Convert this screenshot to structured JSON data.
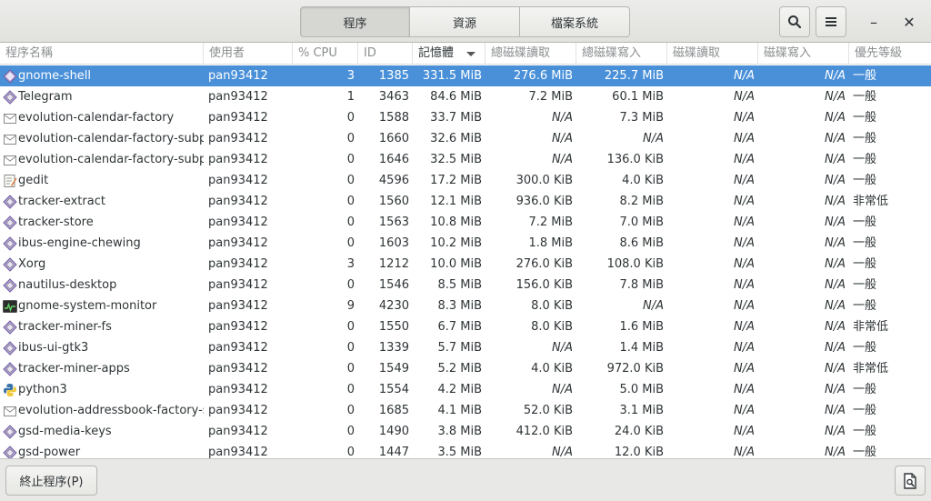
{
  "header": {
    "tabs": [
      {
        "label": "程序",
        "active": true
      },
      {
        "label": "資源",
        "active": false
      },
      {
        "label": "檔案系統",
        "active": false
      }
    ],
    "search_icon": "search-icon",
    "menu_icon": "hamburger-menu-icon",
    "minimize_label": "–",
    "close_label": "✕"
  },
  "columns": [
    {
      "key": "name",
      "label": "程序名稱"
    },
    {
      "key": "user",
      "label": "使用者"
    },
    {
      "key": "cpu",
      "label": "% CPU"
    },
    {
      "key": "id",
      "label": "ID"
    },
    {
      "key": "mem",
      "label": "記憶體",
      "sorted": "descending"
    },
    {
      "key": "disk_read_total",
      "label": "總磁碟讀取"
    },
    {
      "key": "disk_write_total",
      "label": "總磁碟寫入"
    },
    {
      "key": "disk_read",
      "label": "磁碟讀取"
    },
    {
      "key": "disk_write",
      "label": "磁碟寫入"
    },
    {
      "key": "priority",
      "label": "優先等級"
    }
  ],
  "processes": [
    {
      "name": "gnome-shell",
      "icon": "gear-icon",
      "user": "pan93412",
      "cpu": "3",
      "id": "1385",
      "mem": "331.5 MiB",
      "disk_read_total": "276.6 MiB",
      "disk_write_total": "225.7 MiB",
      "disk_read": "N/A",
      "disk_write": "N/A",
      "priority": "一般",
      "selected": true
    },
    {
      "name": "Telegram",
      "icon": "gear-icon",
      "user": "pan93412",
      "cpu": "1",
      "id": "3463",
      "mem": "84.6 MiB",
      "disk_read_total": "7.2 MiB",
      "disk_write_total": "60.1 MiB",
      "disk_read": "N/A",
      "disk_write": "N/A",
      "priority": "一般"
    },
    {
      "name": "evolution-calendar-factory",
      "icon": "envelope-icon",
      "user": "pan93412",
      "cpu": "0",
      "id": "1588",
      "mem": "33.7 MiB",
      "disk_read_total": "N/A",
      "disk_write_total": "7.3 MiB",
      "disk_read": "N/A",
      "disk_write": "N/A",
      "priority": "一般"
    },
    {
      "name": "evolution-calendar-factory-subprocess",
      "icon": "envelope-icon",
      "user": "pan93412",
      "cpu": "0",
      "id": "1660",
      "mem": "32.6 MiB",
      "disk_read_total": "N/A",
      "disk_write_total": "N/A",
      "disk_read": "N/A",
      "disk_write": "N/A",
      "priority": "一般"
    },
    {
      "name": "evolution-calendar-factory-subprocess",
      "icon": "envelope-icon",
      "user": "pan93412",
      "cpu": "0",
      "id": "1646",
      "mem": "32.5 MiB",
      "disk_read_total": "N/A",
      "disk_write_total": "136.0 KiB",
      "disk_read": "N/A",
      "disk_write": "N/A",
      "priority": "一般"
    },
    {
      "name": "gedit",
      "icon": "text-editor-icon",
      "user": "pan93412",
      "cpu": "0",
      "id": "4596",
      "mem": "17.2 MiB",
      "disk_read_total": "300.0 KiB",
      "disk_write_total": "4.0 KiB",
      "disk_read": "N/A",
      "disk_write": "N/A",
      "priority": "一般"
    },
    {
      "name": "tracker-extract",
      "icon": "gear-icon",
      "user": "pan93412",
      "cpu": "0",
      "id": "1560",
      "mem": "12.1 MiB",
      "disk_read_total": "936.0 KiB",
      "disk_write_total": "8.2 MiB",
      "disk_read": "N/A",
      "disk_write": "N/A",
      "priority": "非常低"
    },
    {
      "name": "tracker-store",
      "icon": "gear-icon",
      "user": "pan93412",
      "cpu": "0",
      "id": "1563",
      "mem": "10.8 MiB",
      "disk_read_total": "7.2 MiB",
      "disk_write_total": "7.0 MiB",
      "disk_read": "N/A",
      "disk_write": "N/A",
      "priority": "一般"
    },
    {
      "name": "ibus-engine-chewing",
      "icon": "gear-icon",
      "user": "pan93412",
      "cpu": "0",
      "id": "1603",
      "mem": "10.2 MiB",
      "disk_read_total": "1.8 MiB",
      "disk_write_total": "8.6 MiB",
      "disk_read": "N/A",
      "disk_write": "N/A",
      "priority": "一般"
    },
    {
      "name": "Xorg",
      "icon": "gear-icon",
      "user": "pan93412",
      "cpu": "3",
      "id": "1212",
      "mem": "10.0 MiB",
      "disk_read_total": "276.0 KiB",
      "disk_write_total": "108.0 KiB",
      "disk_read": "N/A",
      "disk_write": "N/A",
      "priority": "一般"
    },
    {
      "name": "nautilus-desktop",
      "icon": "gear-icon",
      "user": "pan93412",
      "cpu": "0",
      "id": "1546",
      "mem": "8.5 MiB",
      "disk_read_total": "156.0 KiB",
      "disk_write_total": "7.8 MiB",
      "disk_read": "N/A",
      "disk_write": "N/A",
      "priority": "一般"
    },
    {
      "name": "gnome-system-monitor",
      "icon": "system-monitor-icon",
      "user": "pan93412",
      "cpu": "9",
      "id": "4230",
      "mem": "8.3 MiB",
      "disk_read_total": "8.0 KiB",
      "disk_write_total": "N/A",
      "disk_read": "N/A",
      "disk_write": "N/A",
      "priority": "一般"
    },
    {
      "name": "tracker-miner-fs",
      "icon": "gear-icon",
      "user": "pan93412",
      "cpu": "0",
      "id": "1550",
      "mem": "6.7 MiB",
      "disk_read_total": "8.0 KiB",
      "disk_write_total": "1.6 MiB",
      "disk_read": "N/A",
      "disk_write": "N/A",
      "priority": "非常低"
    },
    {
      "name": "ibus-ui-gtk3",
      "icon": "gear-icon",
      "user": "pan93412",
      "cpu": "0",
      "id": "1339",
      "mem": "5.7 MiB",
      "disk_read_total": "N/A",
      "disk_write_total": "1.4 MiB",
      "disk_read": "N/A",
      "disk_write": "N/A",
      "priority": "一般"
    },
    {
      "name": "tracker-miner-apps",
      "icon": "gear-icon",
      "user": "pan93412",
      "cpu": "0",
      "id": "1549",
      "mem": "5.2 MiB",
      "disk_read_total": "4.0 KiB",
      "disk_write_total": "972.0 KiB",
      "disk_read": "N/A",
      "disk_write": "N/A",
      "priority": "非常低"
    },
    {
      "name": "python3",
      "icon": "python-icon",
      "user": "pan93412",
      "cpu": "0",
      "id": "1554",
      "mem": "4.2 MiB",
      "disk_read_total": "N/A",
      "disk_write_total": "5.0 MiB",
      "disk_read": "N/A",
      "disk_write": "N/A",
      "priority": "一般"
    },
    {
      "name": "evolution-addressbook-factory-subprocess",
      "icon": "envelope-icon",
      "user": "pan93412",
      "cpu": "0",
      "id": "1685",
      "mem": "4.1 MiB",
      "disk_read_total": "52.0 KiB",
      "disk_write_total": "3.1 MiB",
      "disk_read": "N/A",
      "disk_write": "N/A",
      "priority": "一般"
    },
    {
      "name": "gsd-media-keys",
      "icon": "gear-icon",
      "user": "pan93412",
      "cpu": "0",
      "id": "1490",
      "mem": "3.8 MiB",
      "disk_read_total": "412.0 KiB",
      "disk_write_total": "24.0 KiB",
      "disk_read": "N/A",
      "disk_write": "N/A",
      "priority": "一般"
    },
    {
      "name": "gsd-power",
      "icon": "gear-icon",
      "user": "pan93412",
      "cpu": "0",
      "id": "1447",
      "mem": "3.5 MiB",
      "disk_read_total": "N/A",
      "disk_write_total": "12.0 KiB",
      "disk_read": "N/A",
      "disk_write": "N/A",
      "priority": "一般"
    }
  ],
  "footer": {
    "end_process_label": "終止程序(P)",
    "properties_icon": "document-properties-icon"
  },
  "colors": {
    "selection": "#4a90d9",
    "header_text": "#8b8e8f",
    "text": "#2e3436"
  }
}
